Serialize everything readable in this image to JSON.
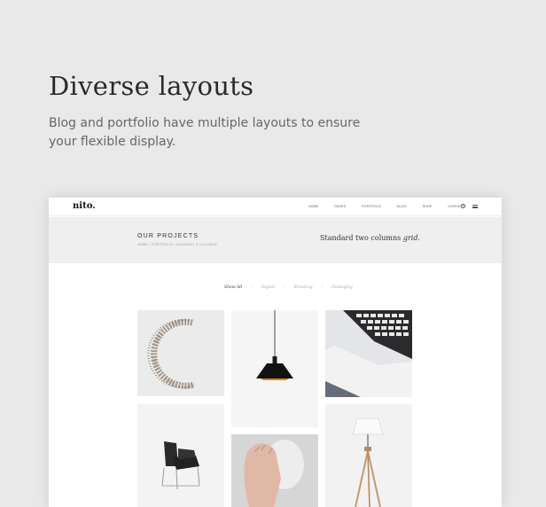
{
  "hero": {
    "title": "Diverse layouts",
    "description": "Blog and portfolio have multiple layouts to ensure your flexible display."
  },
  "mockup": {
    "logo": "nito.",
    "nav": [
      "HOME",
      "PAGES",
      "PORTFOLIO",
      "BLOG",
      "SHOP",
      "CONTACT"
    ],
    "icons": [
      "search-icon",
      "menu-icon"
    ],
    "band": {
      "title": "OUR PROJECTS",
      "breadcrumb": "HOME / PORTFOLIO / MASONRY 3 COLUMNS",
      "subtitle_prefix": "Standard two columns",
      "subtitle_emphasis": "grid."
    },
    "filters": [
      "Show All",
      "Digital",
      "Branding",
      "Packaging"
    ],
    "active_filter": "Show All",
    "tiles": [
      "wreath",
      "pendant-lamp",
      "laptop",
      "chair",
      "hand",
      "floor-lamp"
    ]
  },
  "colors": {
    "page_background": "#e9e9e9",
    "band_background": "#efefef",
    "heading": "#2a2a2a",
    "body_text": "#666666"
  }
}
